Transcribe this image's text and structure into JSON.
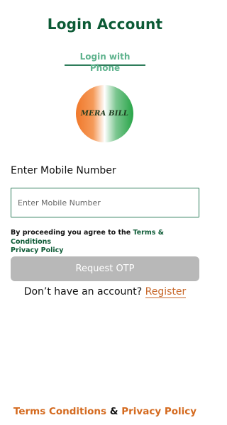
{
  "header": {
    "title": "Login Account",
    "tab_label": "Login with Phone"
  },
  "logo": {
    "text": "MERA BILL"
  },
  "form": {
    "label": "Enter Mobile Number",
    "placeholder": "Enter Mobile Number",
    "consent_prefix": "By proceeding you agree to the ",
    "terms_link": "Terms & Conditions",
    "privacy_link": "Privacy Policy",
    "submit_label": "Request OTP"
  },
  "register": {
    "prompt": "Don’t have an account? ",
    "link": "Register"
  },
  "footer": {
    "terms": "Terms Conditions",
    "separator": "&",
    "privacy": "Privacy Policy"
  },
  "colors": {
    "primary": "#0c5a35",
    "accent": "#d46a1f",
    "disabled_button": "#b8b8b8"
  }
}
